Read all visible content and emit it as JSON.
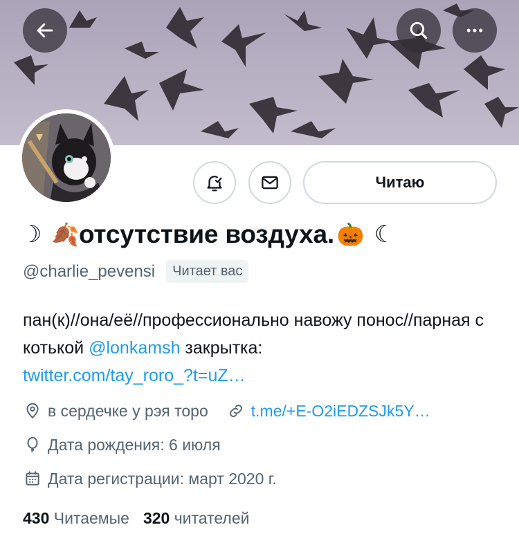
{
  "header": {
    "back_icon": "arrow-left-icon",
    "search_icon": "search-icon",
    "more_icon": "more-horizontal-icon"
  },
  "profile": {
    "name_prefix_glyph": "☽",
    "name_leaf_emoji": "🍂",
    "display_name": "отсутствие воздуха.",
    "name_pumpkin_emoji": "🎃",
    "name_suffix_glyph": "☾",
    "handle": "@charlie_pevensi",
    "follows_you_badge": "Читает вас"
  },
  "actions": {
    "notify_icon": "bell-check-icon",
    "message_icon": "envelope-icon",
    "follow_label": "Читаю"
  },
  "bio": {
    "text_1": "пан(к)//она/её//профессионально навожу понос//парная с котькой ",
    "mention": "@lonkamsh",
    "text_2": " закрытка: ",
    "link": "twitter.com/tay_roro_?t=uZ…"
  },
  "meta": {
    "location": "в сердечке у рэя торо",
    "website": "t.me/+E-O2iEDZSJk5Y…",
    "birthday": "Дата рождения: 6 июля",
    "joined": "Дата регистрации: март 2020 г."
  },
  "stats": {
    "following_count": "430",
    "following_label": "Читаемые",
    "followers_count": "320",
    "followers_label": "читателей"
  },
  "colors": {
    "accent": "#1d9bf0",
    "secondary_text": "#536471",
    "border": "#cfd9de"
  }
}
